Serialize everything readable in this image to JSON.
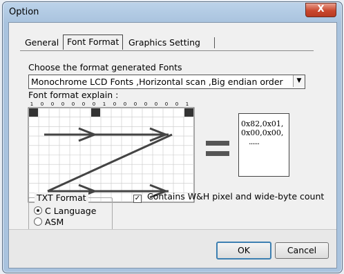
{
  "window": {
    "title": "Option",
    "close_glyph": "X"
  },
  "tabs": [
    {
      "label": "General"
    },
    {
      "label": "Font Format"
    },
    {
      "label": "Graphics Setting"
    }
  ],
  "content": {
    "choose_label": "Choose the format generated Fonts",
    "format_combo": {
      "value": "Monochrome LCD Fonts ,Horizontal scan ,Big endian order",
      "arrow_glyph": "▼"
    },
    "explain_label": "Font format explain :",
    "bit_labels": [
      "1",
      "0",
      "0",
      "0",
      "0",
      "0",
      "0",
      "1",
      "0",
      "0",
      "0",
      "0",
      "0",
      "0",
      "0",
      "1"
    ],
    "hex_lines": [
      "0x82,0x01,",
      "0x00,0x00,",
      "......"
    ],
    "txt_format": {
      "title": "TXT Format",
      "options": [
        {
          "label": "C Language",
          "checked": true
        },
        {
          "label": "ASM",
          "checked": false
        }
      ]
    },
    "contains_checkbox": {
      "label": "Contains W&H pixel and wide-byte count",
      "checked": true,
      "glyph": "✓"
    }
  },
  "buttons": {
    "ok": "OK",
    "cancel": "Cancel"
  },
  "colors": {
    "title_gradient": "#bcd3ea",
    "close_button": "#c9482e",
    "client_bg": "#f0f0f0",
    "arrow": "#444444"
  }
}
